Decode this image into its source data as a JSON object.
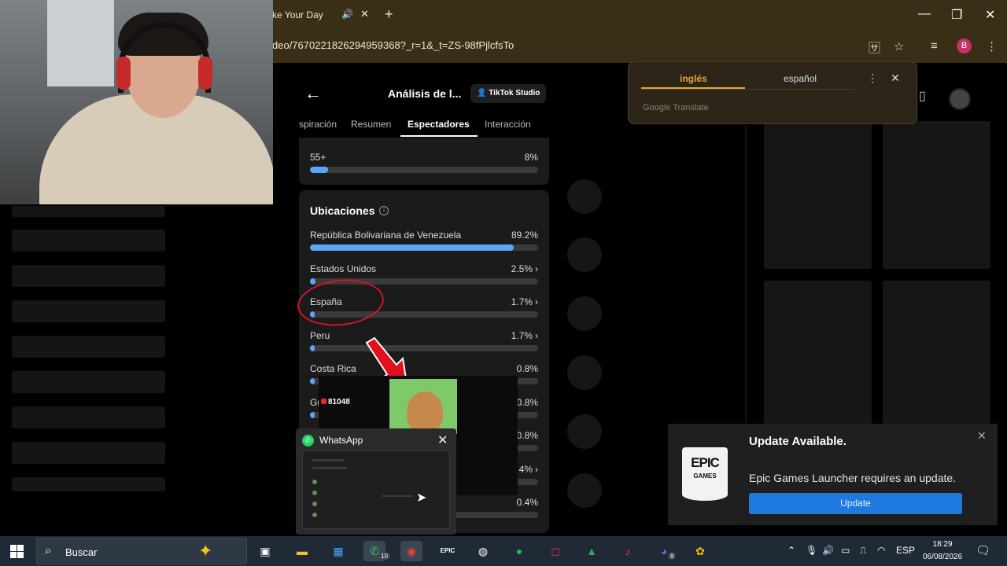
{
  "browser": {
    "tab_title": "ke Your Day",
    "url": "deo/7670221826294959368?_r=1&_t=ZS-98fPjlcfsTo",
    "profile_initial": "B"
  },
  "translate_popup": {
    "source_lang": "inglés",
    "target_lang": "español",
    "brand": "Google Translate"
  },
  "studio": {
    "title": "Análisis de l...",
    "studio_button": "TikTok Studio",
    "tabs": [
      "spiración",
      "Resumen",
      "Espectadores",
      "Interacción"
    ],
    "active_tab": "Espectadores",
    "age_row": {
      "label": "55+",
      "value": "8%",
      "fraction": 0.08
    },
    "locations_title": "Ubicaciones",
    "locations": [
      {
        "label": "República Bolivariana de Venezuela",
        "value": "89.2%",
        "fraction": 0.892,
        "chevron": ""
      },
      {
        "label": "Estados Unidos",
        "value": "2.5%",
        "fraction": 0.025,
        "chevron": "›"
      },
      {
        "label": "España",
        "value": "1.7%",
        "fraction": 0.017,
        "chevron": "›"
      },
      {
        "label": "Peru",
        "value": "1.7%",
        "fraction": 0.017,
        "chevron": "›"
      },
      {
        "label": "Costa Rica",
        "value": "0.8%",
        "fraction": 0.008,
        "chevron": ""
      },
      {
        "label": "Gu",
        "value": "0.8%",
        "fraction": 0.008,
        "chevron": ""
      },
      {
        "label": "",
        "value": "0.8%",
        "fraction": 0.008,
        "chevron": ""
      },
      {
        "label": "",
        "value": "4%",
        "fraction": 0.04,
        "chevron": "›"
      },
      {
        "label": "",
        "value": "0.4%",
        "fraction": 0.004,
        "chevron": ""
      }
    ]
  },
  "overlay": {
    "counter": "81048"
  },
  "whatsapp_preview": {
    "title": "WhatsApp"
  },
  "epic": {
    "logo_line1": "EPIC",
    "logo_line2": "GAMES",
    "title": "Update Available.",
    "message": "Epic Games Launcher requires an update.",
    "button": "Update"
  },
  "taskbar": {
    "search_placeholder": "Buscar",
    "whatsapp_badge": "10",
    "discord_badge": "8",
    "language": "ESP",
    "time": "18:29",
    "date": "06/08/2026"
  },
  "colors": {
    "accent_blue": "#5aa6f5",
    "epic_button": "#1f7ae0",
    "translate_accent": "#e6a53a"
  }
}
